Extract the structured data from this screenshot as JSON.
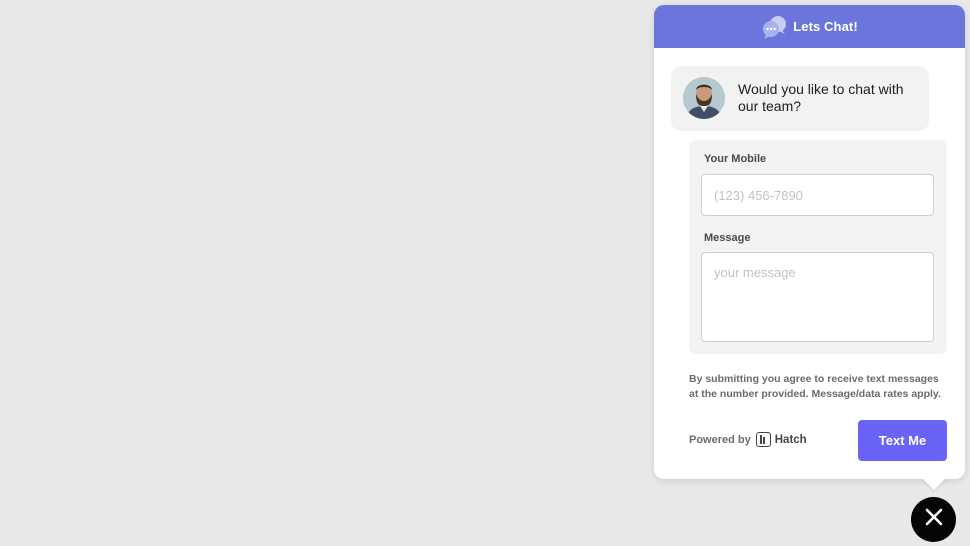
{
  "header": {
    "title": "Lets Chat!",
    "icon": "chat-bubbles-icon",
    "color": "#6a76dc"
  },
  "greeting": {
    "avatar": "agent-avatar",
    "text": "Would you like to chat with our team?"
  },
  "form": {
    "mobile_label": "Your Mobile",
    "mobile_placeholder": "(123) 456-7890",
    "message_label": "Message",
    "message_placeholder": "your message"
  },
  "disclaimer": "By submitting you agree to receive text messages at the number provided. Message/data rates apply.",
  "footer": {
    "powered_by": "Powered by",
    "brand": "Hatch",
    "brand_icon": "hatch-logo-icon",
    "submit_label": "Text Me",
    "submit_color": "#6b62f6"
  },
  "close_button": {
    "icon": "close-icon"
  }
}
